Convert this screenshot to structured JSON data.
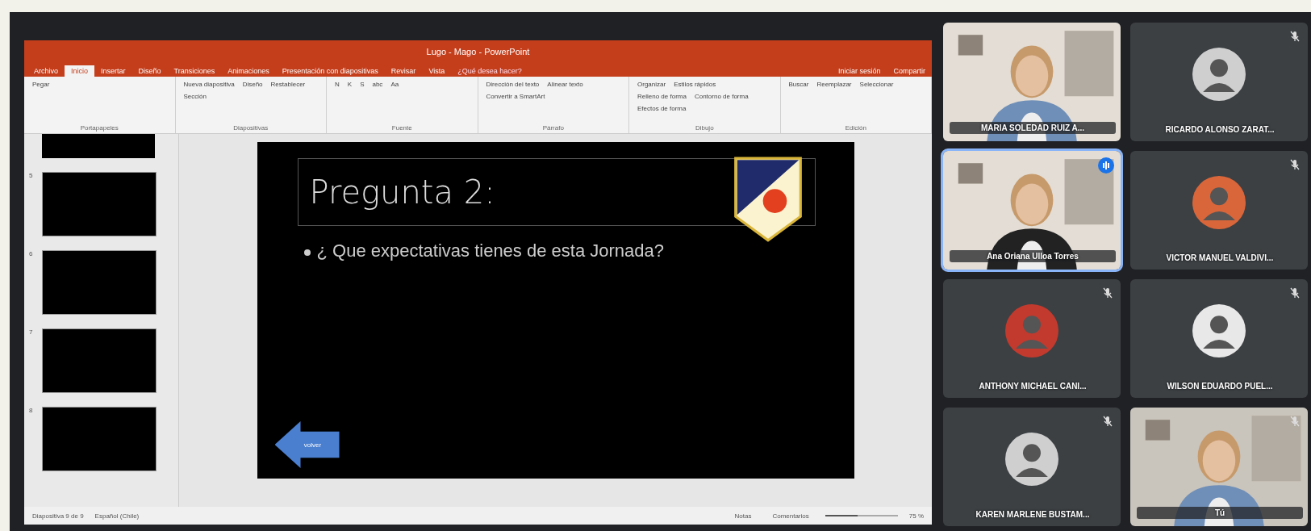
{
  "powerpoint": {
    "title": "Lugo - Mago - PowerPoint",
    "tabs": [
      {
        "label": "Archivo",
        "selected": false
      },
      {
        "label": "Inicio",
        "selected": true
      },
      {
        "label": "Insertar",
        "selected": false
      },
      {
        "label": "Diseño",
        "selected": false
      },
      {
        "label": "Transiciones",
        "selected": false
      },
      {
        "label": "Animaciones",
        "selected": false
      },
      {
        "label": "Presentación con diapositivas",
        "selected": false
      },
      {
        "label": "Revisar",
        "selected": false
      },
      {
        "label": "Vista",
        "selected": false
      }
    ],
    "tell_me": "¿Qué desea hacer?",
    "sign_in": "Iniciar sesión",
    "share": "Compartir",
    "groups": [
      {
        "label": "Portapapeles",
        "buttons": [
          "Pegar"
        ]
      },
      {
        "label": "Diapositivas",
        "buttons": [
          "Nueva diapositiva",
          "Diseño",
          "Restablecer",
          "Sección"
        ]
      },
      {
        "label": "Fuente",
        "buttons": [
          "N",
          "K",
          "S",
          "abc",
          "Aa"
        ]
      },
      {
        "label": "Párrafo",
        "buttons": [
          "Dirección del texto",
          "Alinear texto",
          "Convertir a SmartArt"
        ]
      },
      {
        "label": "Dibujo",
        "buttons": [
          "Organizar",
          "Estilos rápidos",
          "Relleno de forma",
          "Contorno de forma",
          "Efectos de forma"
        ]
      },
      {
        "label": "Edición",
        "buttons": [
          "Buscar",
          "Reemplazar",
          "Seleccionar"
        ]
      }
    ],
    "thumbnails": [
      {
        "number": "5",
        "selected": false
      },
      {
        "number": "6",
        "selected": false
      },
      {
        "number": "7",
        "selected": false
      },
      {
        "number": "8",
        "selected": false
      }
    ],
    "slide": {
      "title": "Pregunta 2:",
      "bullet": "¿ Que expectativas tienes de esta Jornada?",
      "back_button": "volver"
    },
    "status_bar": {
      "slide_count": "Diapositiva 9 de 9",
      "language": "Español (Chile)",
      "notes": "Notas",
      "comments": "Comentarios",
      "zoom": "75 %",
      "level": 0.45
    }
  },
  "participants": [
    {
      "name": "MARIA SOLEDAD RUIZ A...",
      "kind": "video",
      "muted": false,
      "speaking": false
    },
    {
      "name": "RICARDO ALONSO ZARAT...",
      "kind": "avatar",
      "muted": true,
      "speaking": false
    },
    {
      "name": "Ana Oriana Ulloa Torres",
      "kind": "video",
      "muted": false,
      "speaking": true
    },
    {
      "name": "VICTOR MANUEL VALDIVI...",
      "kind": "avatar",
      "muted": true,
      "speaking": false
    },
    {
      "name": "ANTHONY MICHAEL CANI...",
      "kind": "avatar",
      "muted": true,
      "speaking": false
    },
    {
      "name": "WILSON EDUARDO PUEL...",
      "kind": "avatar",
      "muted": true,
      "speaking": false
    },
    {
      "name": "KAREN MARLENE BUSTAM...",
      "kind": "avatar",
      "muted": true,
      "speaking": false
    },
    {
      "name": "Tú",
      "kind": "video",
      "muted": true,
      "speaking": false
    }
  ]
}
